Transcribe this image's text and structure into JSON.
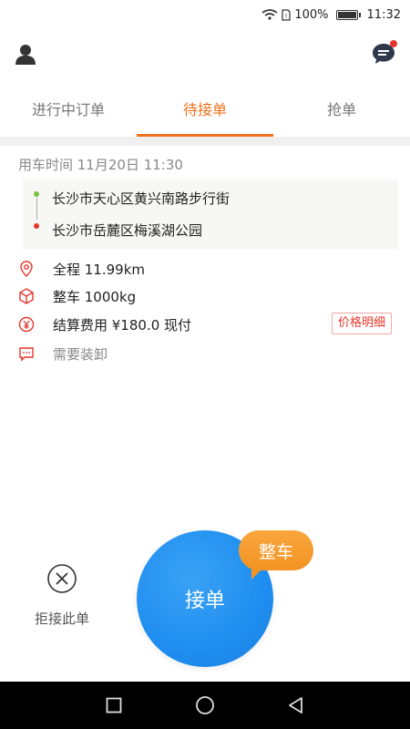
{
  "status_bar": {
    "battery": "100%",
    "time": "11:32",
    "battery_level": 1.0
  },
  "tabs": [
    {
      "label": "进行中订单",
      "active": false
    },
    {
      "label": "待接单",
      "active": true
    },
    {
      "label": "抢单",
      "active": false
    }
  ],
  "order": {
    "time_label": "用车时间 11月20日 11:30",
    "start_address": "长沙市天心区黄兴南路步行街",
    "end_address": "长沙市岳麓区梅溪湖公园",
    "distance": "全程 11.99km",
    "cargo": "整车 1000kg",
    "fee": "结算费用 ¥180.0 现付",
    "price_detail_btn": "价格明细",
    "loading": "需要装卸"
  },
  "actions": {
    "reject_label": "拒接此单",
    "accept_label": "接单",
    "tag_label": "整车"
  },
  "colors": {
    "accent": "#f2711c",
    "accept_blue": "#1f8ef0",
    "tag_orange": "#f39323",
    "red": "#e5352b",
    "green": "#7ac143"
  },
  "icons": [
    "wifi-icon",
    "sim-icon",
    "battery-icon",
    "user-icon",
    "message-icon",
    "location-icon",
    "box-icon",
    "yuan-icon",
    "chat-icon",
    "close-circle-icon",
    "square-icon",
    "circle-icon",
    "back-triangle-icon"
  ]
}
